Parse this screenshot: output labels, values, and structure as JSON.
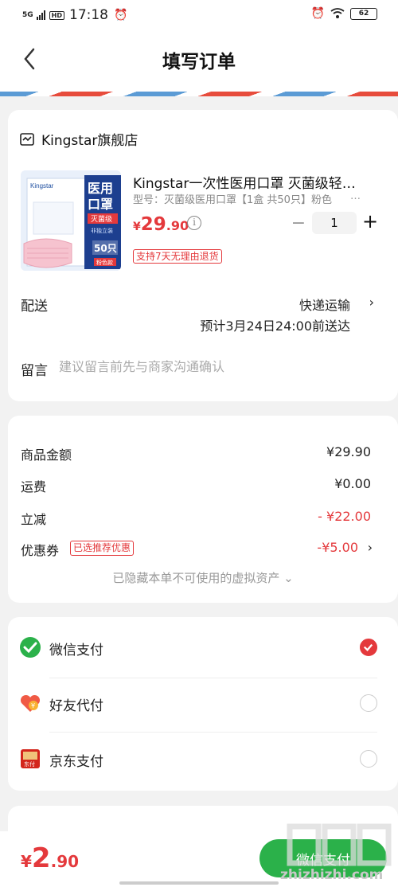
{
  "status_bar": {
    "network": "5G",
    "hd": "HD",
    "time": "17:18",
    "battery": "62"
  },
  "header": {
    "title": "填写订单"
  },
  "store": {
    "name": "Kingstar旗舰店"
  },
  "product": {
    "title": "Kingstar一次性医用口罩 灭菌级轻…",
    "spec": "型号：灭菌级医用口罩【1盒 共50只】粉色",
    "spec_more": "…",
    "price_currency": "¥",
    "price_int": "29",
    "price_dec": ".90",
    "quantity": "1",
    "return_tag": "支持7天无理由退货",
    "image_texts": {
      "brand": "Kingstar",
      "l1": "医用",
      "l2": "口罩",
      "badge": "灭菌级",
      "sub": "非独立装",
      "count": "50只",
      "strip": "粉色款"
    }
  },
  "shipping": {
    "label": "配送",
    "method": "快递运输",
    "eta": "预计3月24日24:00前送达"
  },
  "note": {
    "label": "留言",
    "placeholder": "建议留言前先与商家沟通确认"
  },
  "amounts": {
    "goods_label": "商品金额",
    "goods_value": "¥29.90",
    "freight_label": "运费",
    "freight_value": "¥0.00",
    "discount_label": "立减",
    "discount_value": "- ¥22.00",
    "coupon_label": "优惠券",
    "coupon_tag": "已选推荐优惠",
    "coupon_value": "-¥5.00",
    "hidden_assets": "已隐藏本单不可使用的虚拟资产 ⌄"
  },
  "payment": [
    {
      "label": "微信支付",
      "selected": true
    },
    {
      "label": "好友代付",
      "selected": false
    },
    {
      "label": "京东支付",
      "selected": false
    }
  ],
  "footer": {
    "currency": "¥",
    "total_int": "2",
    "total_dec": ".90",
    "pay_button": "微信支付",
    "watermark": "zhizhizhi.com"
  },
  "colors": {
    "accent": "#e4393c",
    "wechat": "#2bb14a",
    "background": "#f2f2f2"
  }
}
